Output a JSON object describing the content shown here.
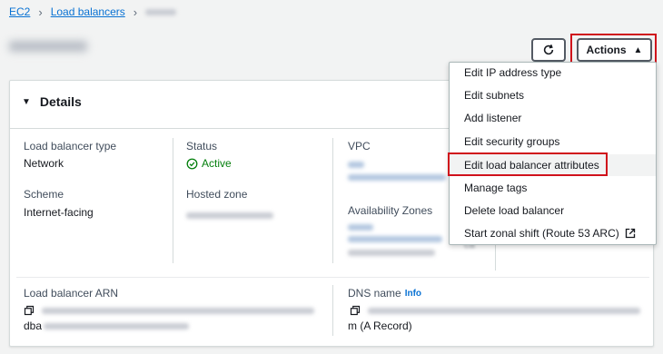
{
  "breadcrumb": {
    "items": [
      {
        "label": "EC2"
      },
      {
        "label": "Load balancers"
      }
    ]
  },
  "toolbar": {
    "actions_label": "Actions"
  },
  "details": {
    "title": "Details",
    "fields": {
      "lb_type": {
        "label": "Load balancer type",
        "value": "Network"
      },
      "status": {
        "label": "Status",
        "value": "Active"
      },
      "vpc": {
        "label": "VPC"
      },
      "scheme": {
        "label": "Scheme",
        "value": "Internet-facing"
      },
      "hosted_zone": {
        "label": "Hosted zone"
      },
      "az": {
        "label": "Availability Zones"
      },
      "arn": {
        "label": "Load balancer ARN",
        "value_fragment": "dba"
      },
      "dns": {
        "label": "DNS name",
        "info": "Info",
        "value_fragment": "m (A Record)"
      }
    }
  },
  "actions_menu": {
    "items": [
      {
        "label": "Edit IP address type"
      },
      {
        "label": "Edit subnets"
      },
      {
        "label": "Add listener"
      },
      {
        "label": "Edit security groups"
      },
      {
        "label": "Edit load balancer attributes"
      },
      {
        "label": "Manage tags"
      },
      {
        "label": "Delete load balancer"
      },
      {
        "label": "Start zonal shift (Route 53 ARC)"
      }
    ]
  },
  "colors": {
    "link": "#0972d3",
    "success": "#037f0c",
    "highlight": "#d0111b"
  }
}
